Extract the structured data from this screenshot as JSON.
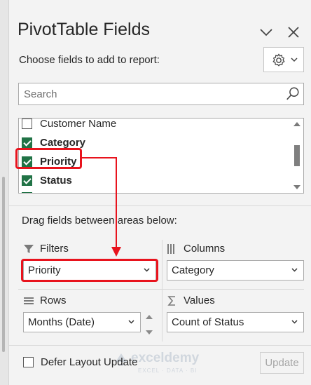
{
  "panel": {
    "title": "PivotTable Fields",
    "subtitle": "Choose fields to add to report:"
  },
  "search": {
    "placeholder": "Search"
  },
  "fields": [
    {
      "label": "Customer Name",
      "checked": false,
      "bold": false
    },
    {
      "label": "Category",
      "checked": true,
      "bold": true
    },
    {
      "label": "Priority",
      "checked": true,
      "bold": true
    },
    {
      "label": "Status",
      "checked": true,
      "bold": true
    }
  ],
  "areas": {
    "drag_label": "Drag fields between areas below:",
    "filters": {
      "label": "Filters",
      "item": "Priority"
    },
    "columns": {
      "label": "Columns",
      "item": "Category"
    },
    "rows": {
      "label": "Rows",
      "item": "Months (Date)"
    },
    "values": {
      "label": "Values",
      "item": "Count of Status"
    }
  },
  "footer": {
    "defer_label": "Defer Layout Update",
    "defer_checked": false,
    "update_label": "Update"
  },
  "watermark": {
    "name": "exceldemy",
    "sub": "EXCEL · DATA · BI"
  },
  "icons": {
    "close": "close-icon",
    "collapse": "chevron-down-icon",
    "settings": "gear-icon",
    "search": "search-icon",
    "filters": "filter-icon",
    "columns": "columns-icon",
    "rows": "rows-icon",
    "values": "sigma-icon"
  },
  "colors": {
    "checkbox_checked": "#217346",
    "highlight": "#e8131d",
    "panel_bg": "#f3f3f3"
  }
}
